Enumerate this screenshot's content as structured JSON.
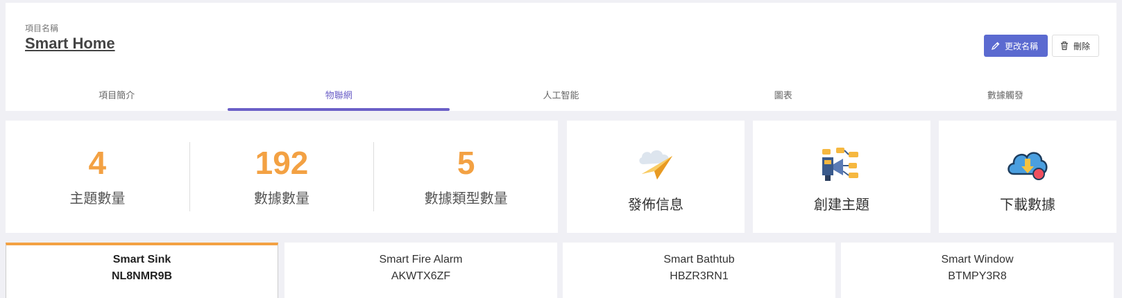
{
  "header": {
    "project_label": "項目名稱",
    "project_name": "Smart Home",
    "rename_label": "更改名稱",
    "delete_label": "刪除"
  },
  "tabs": [
    {
      "label": "項目簡介",
      "active": false
    },
    {
      "label": "物聯網",
      "active": true
    },
    {
      "label": "人工智能",
      "active": false
    },
    {
      "label": "圖表",
      "active": false
    },
    {
      "label": "數據觸發",
      "active": false
    }
  ],
  "stats": [
    {
      "value": "4",
      "label": "主題數量"
    },
    {
      "value": "192",
      "label": "數據數量"
    },
    {
      "value": "5",
      "label": "數據類型數量"
    }
  ],
  "actions": [
    {
      "label": "發佈信息",
      "icon": "paper-plane-cloud-icon"
    },
    {
      "label": "創建主題",
      "icon": "topic-network-icon"
    },
    {
      "label": "下載數據",
      "icon": "cloud-download-icon"
    }
  ],
  "devices": [
    {
      "name": "Smart Sink",
      "code": "NL8NMR9B",
      "active": true
    },
    {
      "name": "Smart Fire Alarm",
      "code": "AKWTX6ZF",
      "active": false
    },
    {
      "name": "Smart Bathtub",
      "code": "HBZR3RN1",
      "active": false
    },
    {
      "name": "Smart Window",
      "code": "BTMPY3R8",
      "active": false
    }
  ],
  "colors": {
    "accent": "#5b6ad0",
    "tab_active": "#6b5fc7",
    "stat_orange": "#f3a143"
  }
}
